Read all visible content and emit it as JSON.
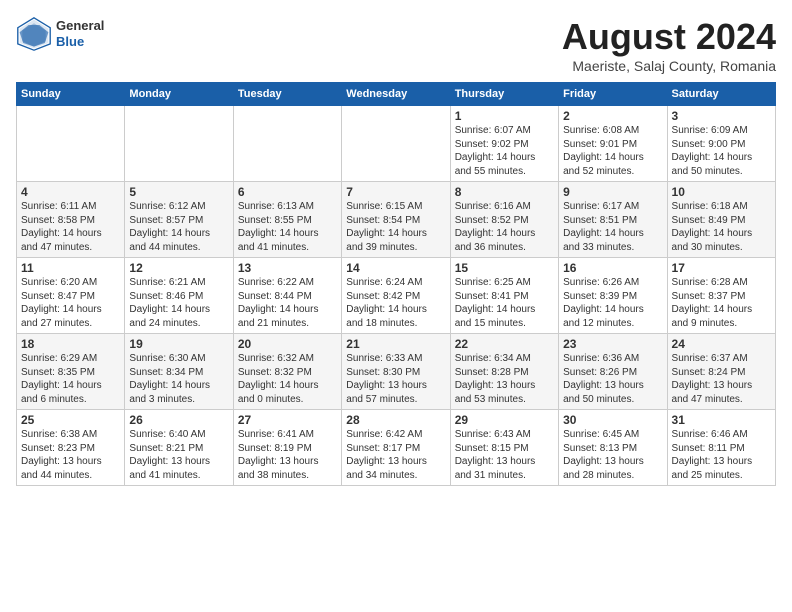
{
  "header": {
    "title": "August 2024",
    "location": "Maeriste, Salaj County, Romania",
    "logo_general": "General",
    "logo_blue": "Blue"
  },
  "calendar": {
    "days_of_week": [
      "Sunday",
      "Monday",
      "Tuesday",
      "Wednesday",
      "Thursday",
      "Friday",
      "Saturday"
    ],
    "weeks": [
      [
        {
          "day": "",
          "content": ""
        },
        {
          "day": "",
          "content": ""
        },
        {
          "day": "",
          "content": ""
        },
        {
          "day": "",
          "content": ""
        },
        {
          "day": "1",
          "content": "Sunrise: 6:07 AM\nSunset: 9:02 PM\nDaylight: 14 hours\nand 55 minutes."
        },
        {
          "day": "2",
          "content": "Sunrise: 6:08 AM\nSunset: 9:01 PM\nDaylight: 14 hours\nand 52 minutes."
        },
        {
          "day": "3",
          "content": "Sunrise: 6:09 AM\nSunset: 9:00 PM\nDaylight: 14 hours\nand 50 minutes."
        }
      ],
      [
        {
          "day": "4",
          "content": "Sunrise: 6:11 AM\nSunset: 8:58 PM\nDaylight: 14 hours\nand 47 minutes."
        },
        {
          "day": "5",
          "content": "Sunrise: 6:12 AM\nSunset: 8:57 PM\nDaylight: 14 hours\nand 44 minutes."
        },
        {
          "day": "6",
          "content": "Sunrise: 6:13 AM\nSunset: 8:55 PM\nDaylight: 14 hours\nand 41 minutes."
        },
        {
          "day": "7",
          "content": "Sunrise: 6:15 AM\nSunset: 8:54 PM\nDaylight: 14 hours\nand 39 minutes."
        },
        {
          "day": "8",
          "content": "Sunrise: 6:16 AM\nSunset: 8:52 PM\nDaylight: 14 hours\nand 36 minutes."
        },
        {
          "day": "9",
          "content": "Sunrise: 6:17 AM\nSunset: 8:51 PM\nDaylight: 14 hours\nand 33 minutes."
        },
        {
          "day": "10",
          "content": "Sunrise: 6:18 AM\nSunset: 8:49 PM\nDaylight: 14 hours\nand 30 minutes."
        }
      ],
      [
        {
          "day": "11",
          "content": "Sunrise: 6:20 AM\nSunset: 8:47 PM\nDaylight: 14 hours\nand 27 minutes."
        },
        {
          "day": "12",
          "content": "Sunrise: 6:21 AM\nSunset: 8:46 PM\nDaylight: 14 hours\nand 24 minutes."
        },
        {
          "day": "13",
          "content": "Sunrise: 6:22 AM\nSunset: 8:44 PM\nDaylight: 14 hours\nand 21 minutes."
        },
        {
          "day": "14",
          "content": "Sunrise: 6:24 AM\nSunset: 8:42 PM\nDaylight: 14 hours\nand 18 minutes."
        },
        {
          "day": "15",
          "content": "Sunrise: 6:25 AM\nSunset: 8:41 PM\nDaylight: 14 hours\nand 15 minutes."
        },
        {
          "day": "16",
          "content": "Sunrise: 6:26 AM\nSunset: 8:39 PM\nDaylight: 14 hours\nand 12 minutes."
        },
        {
          "day": "17",
          "content": "Sunrise: 6:28 AM\nSunset: 8:37 PM\nDaylight: 14 hours\nand 9 minutes."
        }
      ],
      [
        {
          "day": "18",
          "content": "Sunrise: 6:29 AM\nSunset: 8:35 PM\nDaylight: 14 hours\nand 6 minutes."
        },
        {
          "day": "19",
          "content": "Sunrise: 6:30 AM\nSunset: 8:34 PM\nDaylight: 14 hours\nand 3 minutes."
        },
        {
          "day": "20",
          "content": "Sunrise: 6:32 AM\nSunset: 8:32 PM\nDaylight: 14 hours\nand 0 minutes."
        },
        {
          "day": "21",
          "content": "Sunrise: 6:33 AM\nSunset: 8:30 PM\nDaylight: 13 hours\nand 57 minutes."
        },
        {
          "day": "22",
          "content": "Sunrise: 6:34 AM\nSunset: 8:28 PM\nDaylight: 13 hours\nand 53 minutes."
        },
        {
          "day": "23",
          "content": "Sunrise: 6:36 AM\nSunset: 8:26 PM\nDaylight: 13 hours\nand 50 minutes."
        },
        {
          "day": "24",
          "content": "Sunrise: 6:37 AM\nSunset: 8:24 PM\nDaylight: 13 hours\nand 47 minutes."
        }
      ],
      [
        {
          "day": "25",
          "content": "Sunrise: 6:38 AM\nSunset: 8:23 PM\nDaylight: 13 hours\nand 44 minutes."
        },
        {
          "day": "26",
          "content": "Sunrise: 6:40 AM\nSunset: 8:21 PM\nDaylight: 13 hours\nand 41 minutes."
        },
        {
          "day": "27",
          "content": "Sunrise: 6:41 AM\nSunset: 8:19 PM\nDaylight: 13 hours\nand 38 minutes."
        },
        {
          "day": "28",
          "content": "Sunrise: 6:42 AM\nSunset: 8:17 PM\nDaylight: 13 hours\nand 34 minutes."
        },
        {
          "day": "29",
          "content": "Sunrise: 6:43 AM\nSunset: 8:15 PM\nDaylight: 13 hours\nand 31 minutes."
        },
        {
          "day": "30",
          "content": "Sunrise: 6:45 AM\nSunset: 8:13 PM\nDaylight: 13 hours\nand 28 minutes."
        },
        {
          "day": "31",
          "content": "Sunrise: 6:46 AM\nSunset: 8:11 PM\nDaylight: 13 hours\nand 25 minutes."
        }
      ]
    ]
  }
}
